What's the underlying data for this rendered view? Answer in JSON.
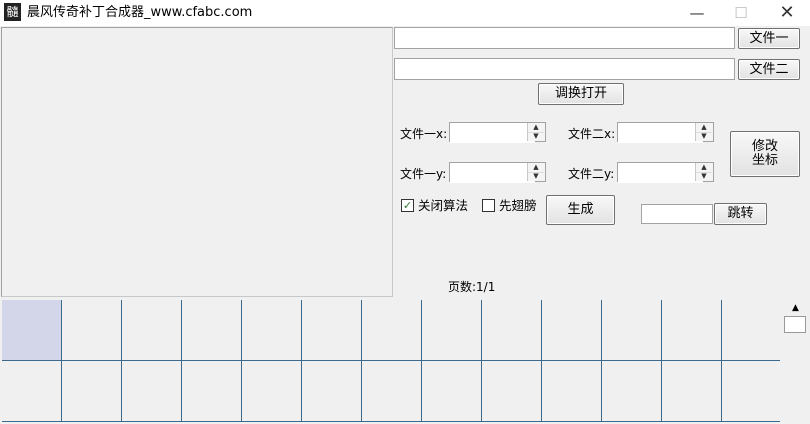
{
  "window": {
    "title": "晨风传奇补丁合成器_www.cfabc.com",
    "icon_glyph": "髓",
    "minimize": "—",
    "maximize": "☐",
    "close": "✕"
  },
  "files": {
    "file1_value": "",
    "file1_button": "文件一",
    "file2_value": "",
    "file2_button": "文件二",
    "swap_button": "调换打开"
  },
  "coords": {
    "file1_x_label": "文件一x:",
    "file1_y_label": "文件一y:",
    "file2_x_label": "文件二x:",
    "file2_y_label": "文件二y:",
    "file1_x_value": "",
    "file1_y_value": "",
    "file2_x_value": "",
    "file2_y_value": "",
    "modify_button_line1": "修改",
    "modify_button_line2": "坐标"
  },
  "options": {
    "close_algorithm_label": "关闭算法",
    "close_algorithm_checked": true,
    "first_wings_label": "先翅膀",
    "first_wings_checked": false,
    "generate_button": "生成",
    "jump_value": "",
    "jump_button": "跳转"
  },
  "pager": {
    "page_label": "页数:1/1"
  },
  "icons": {
    "spin_up": "▲",
    "spin_down": "▼",
    "check_mark": "✓",
    "scroll_up": "▲"
  },
  "colors": {
    "grid_line": "#3c6a8e",
    "selected_cell": "#d3d6e8",
    "client_bg": "#f0f0f0"
  }
}
